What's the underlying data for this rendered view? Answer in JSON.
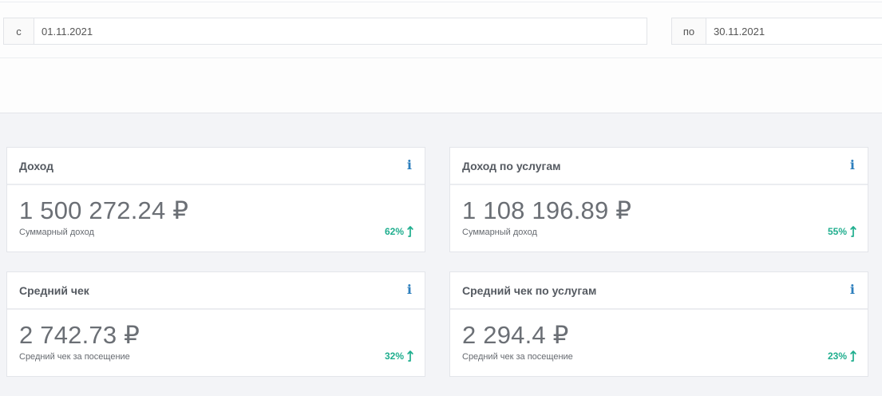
{
  "filters": {
    "from_label": "с",
    "from_value": "01.11.2021",
    "to_label": "по",
    "to_value": "30.11.2021"
  },
  "cards": [
    {
      "title": "Доход",
      "value": "1 500 272.24 ₽",
      "caption": "Суммарный доход",
      "percent": "62%",
      "trend_icon": "arrow-up-icon",
      "info_icon": "info-icon"
    },
    {
      "title": "Доход по услугам",
      "value": "1 108 196.89 ₽",
      "caption": "Суммарный доход",
      "percent": "55%",
      "trend_icon": "arrow-up-icon",
      "info_icon": "info-icon"
    },
    {
      "title": "Средний чек",
      "value": "2 742.73 ₽",
      "caption": "Средний чек за посещение",
      "percent": "32%",
      "trend_icon": "arrow-up-icon",
      "info_icon": "info-icon"
    },
    {
      "title": "Средний чек по услугам",
      "value": "2 294.4 ₽",
      "caption": "Средний чек за посещение",
      "percent": "23%",
      "trend_icon": "arrow-up-icon",
      "info_icon": "info-icon"
    }
  ],
  "colors": {
    "accent_green": "#1fae8e",
    "info_blue": "#2d7fbd",
    "background": "#f3f4f7"
  }
}
